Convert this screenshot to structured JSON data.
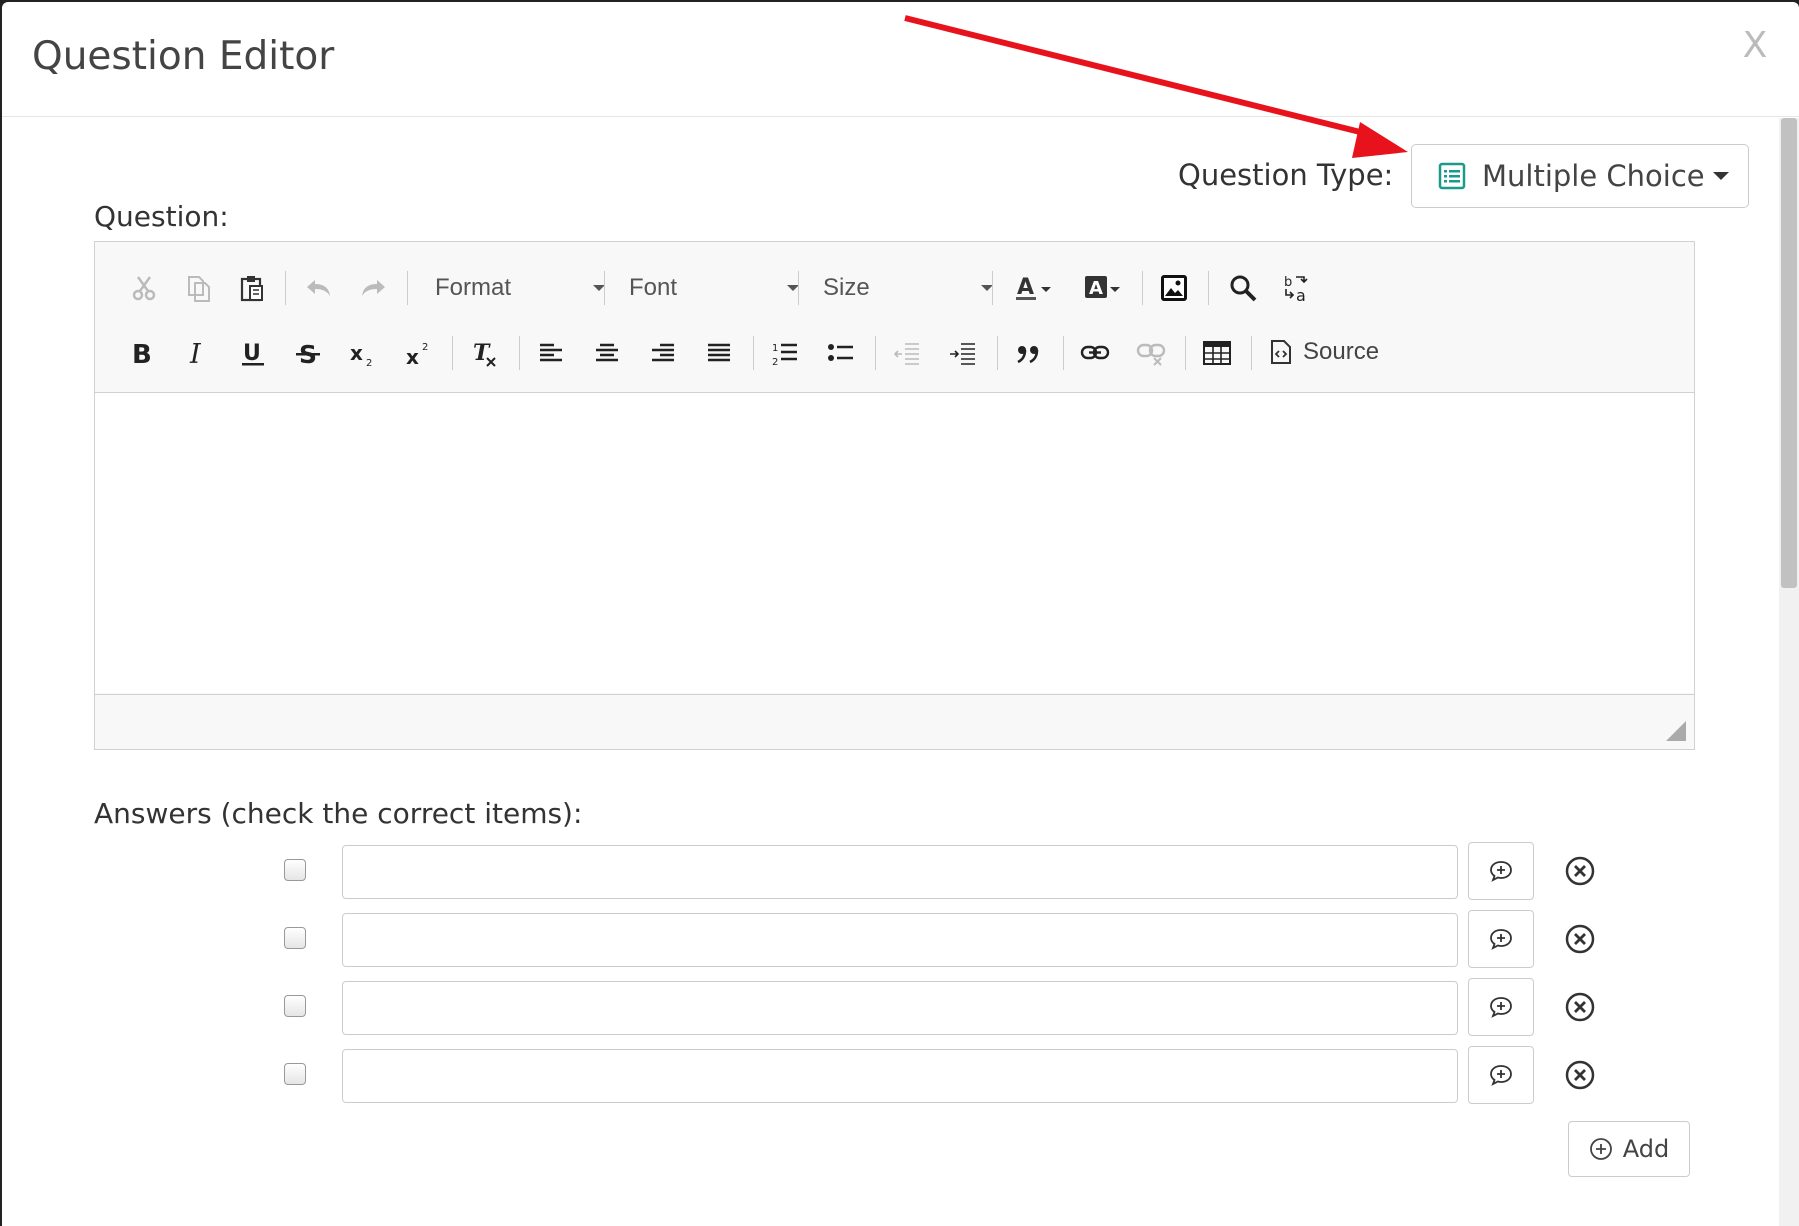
{
  "modal": {
    "title": "Question Editor",
    "close_label": "X"
  },
  "question_type": {
    "label": "Question Type:",
    "value": "Multiple Choice",
    "icon": "list-icon"
  },
  "question": {
    "label": "Question:"
  },
  "editor": {
    "format_label": "Format",
    "font_label": "Font",
    "size_label": "Size",
    "source_label": "Source",
    "content": ""
  },
  "answers": {
    "label": "Answers (check the correct items):",
    "items": [
      {
        "checked": false,
        "value": ""
      },
      {
        "checked": false,
        "value": ""
      },
      {
        "checked": false,
        "value": ""
      },
      {
        "checked": false,
        "value": ""
      }
    ],
    "add_label": "Add"
  },
  "colors": {
    "accent_teal": "#1a9a8c",
    "annotation_arrow": "#e8121c"
  }
}
